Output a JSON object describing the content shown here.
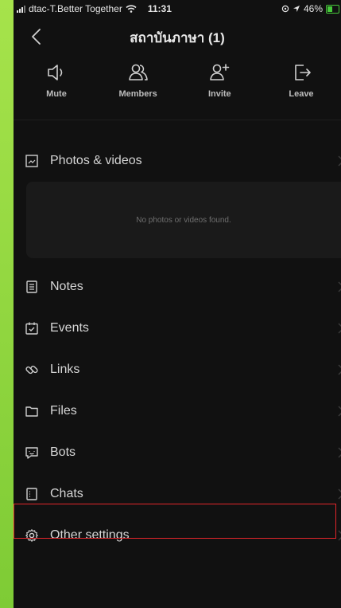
{
  "status_bar": {
    "carrier": "dtac-T.Better Together",
    "time": "11:31",
    "battery_text": "46%",
    "battery_level": 0.46,
    "colors": {
      "battery": "#46c93a"
    }
  },
  "header": {
    "title": "สถาบันภาษา (1)"
  },
  "actions": [
    {
      "label": "Mute",
      "icon": "speaker-icon"
    },
    {
      "label": "Members",
      "icon": "members-icon"
    },
    {
      "label": "Invite",
      "icon": "invite-icon"
    },
    {
      "label": "Leave",
      "icon": "leave-icon"
    }
  ],
  "photos": {
    "label": "Photos & videos",
    "empty_text": "No photos or videos found."
  },
  "menu": [
    {
      "label": "Notes",
      "icon": "notes-icon"
    },
    {
      "label": "Events",
      "icon": "calendar-icon"
    },
    {
      "label": "Links",
      "icon": "link-icon"
    },
    {
      "label": "Files",
      "icon": "folder-icon"
    },
    {
      "label": "Bots",
      "icon": "bot-icon"
    },
    {
      "label": "Chats",
      "icon": "chats-icon"
    },
    {
      "label": "Other settings",
      "icon": "gear-icon"
    }
  ],
  "colors": {
    "background": "#111111",
    "highlight": "#e3262b",
    "side_strip": "#8cd43c"
  }
}
